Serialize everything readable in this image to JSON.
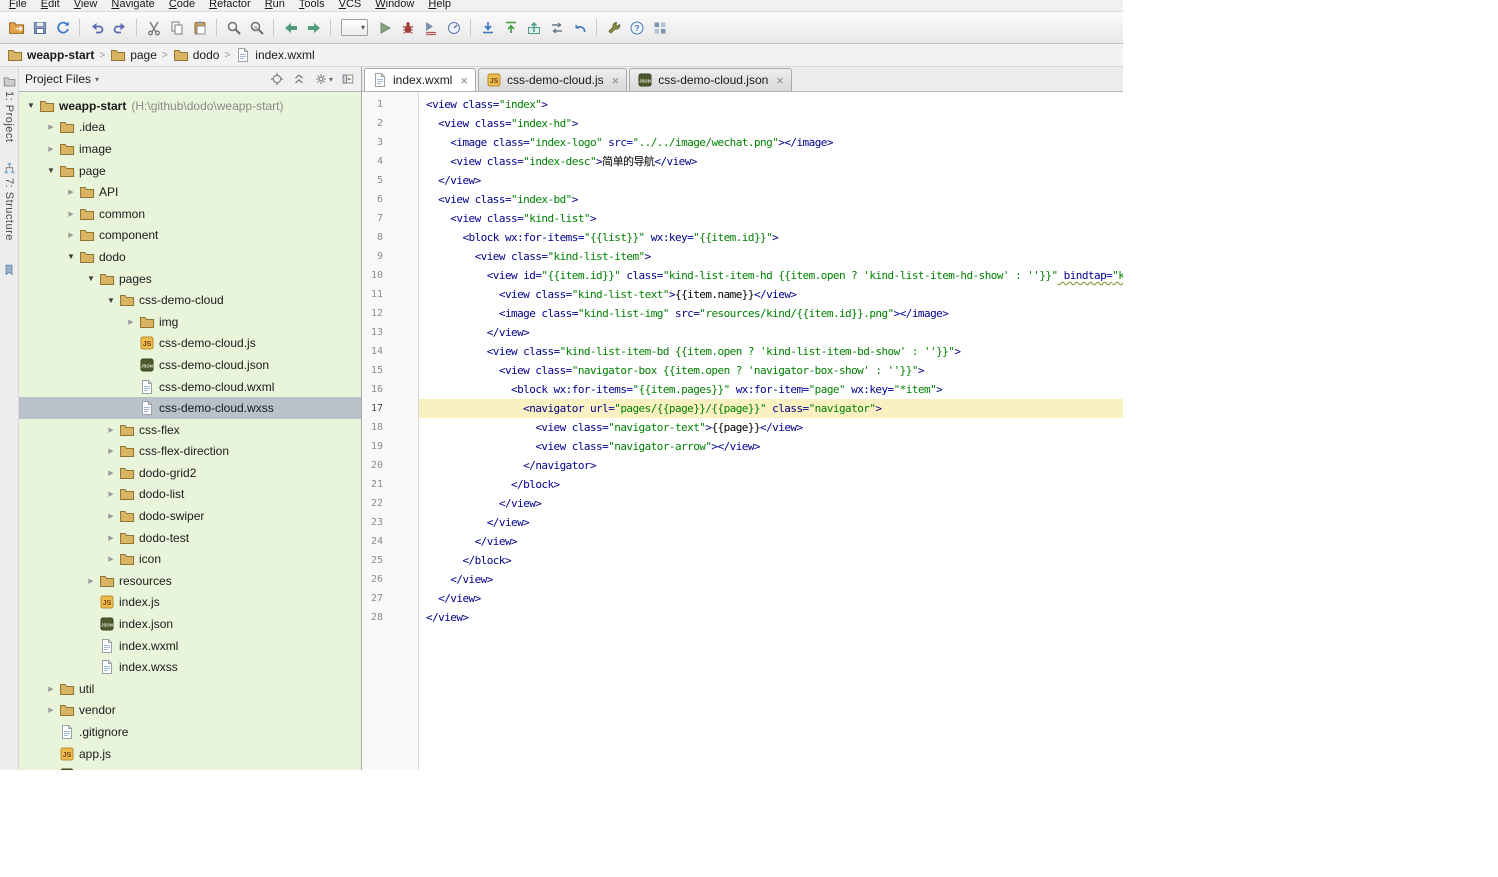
{
  "menu": {
    "items": [
      "File",
      "Edit",
      "View",
      "Navigate",
      "Code",
      "Refactor",
      "Run",
      "Tools",
      "VCS",
      "Window",
      "Help"
    ]
  },
  "toolbar": {
    "items": [
      {
        "icon": "open-icon"
      },
      {
        "icon": "save-icon"
      },
      {
        "icon": "sync-icon"
      },
      {
        "sep": true
      },
      {
        "icon": "undo-icon"
      },
      {
        "icon": "redo-icon"
      },
      {
        "sep": true
      },
      {
        "icon": "cut-icon"
      },
      {
        "icon": "copy-icon"
      },
      {
        "icon": "paste-icon"
      },
      {
        "sep": true
      },
      {
        "icon": "find-icon"
      },
      {
        "icon": "replace-icon"
      },
      {
        "sep": true
      },
      {
        "icon": "back-icon"
      },
      {
        "icon": "forward-icon"
      },
      {
        "sep": true
      },
      {
        "combo": "run-config-selector"
      },
      {
        "icon": "run-icon"
      },
      {
        "icon": "debug-icon"
      },
      {
        "icon": "coverage-icon"
      },
      {
        "icon": "profiler-icon"
      },
      {
        "sep": true
      },
      {
        "icon": "vcs-update-icon"
      },
      {
        "icon": "vcs-commit-icon"
      },
      {
        "icon": "vcs-push-icon"
      },
      {
        "icon": "vcs-compare-icon"
      },
      {
        "icon": "rollback-icon"
      },
      {
        "sep": true
      },
      {
        "icon": "settings-wrench-icon"
      },
      {
        "icon": "help-icon"
      },
      {
        "icon": "project-structure-icon"
      }
    ]
  },
  "breadcrumbs": {
    "separator": ">",
    "items": [
      {
        "label": "weapp-start",
        "icon": "folder",
        "bold": true
      },
      {
        "label": "page",
        "icon": "folder"
      },
      {
        "label": "dodo",
        "icon": "folder"
      },
      {
        "label": "index.wxml",
        "icon": "file"
      }
    ]
  },
  "tool_strip": {
    "buttons": [
      {
        "label": "1: Project",
        "icon": "project-tool-icon"
      },
      {
        "label": "7: Structure",
        "icon": "structure-tool-icon"
      }
    ]
  },
  "project_panel": {
    "header": {
      "label": "Project Files",
      "icons": [
        "locate-icon",
        "collapse-all-icon",
        "gear-icon",
        "hide-panel-icon"
      ]
    },
    "tree": [
      {
        "label": "weapp-start",
        "suffix": " (H:\\github\\dodo\\weapp-start)",
        "depth": 0,
        "icon": "folder",
        "state": "expanded",
        "bold": true
      },
      {
        "label": ".idea",
        "depth": 1,
        "icon": "folder",
        "state": "collapsed"
      },
      {
        "label": "image",
        "depth": 1,
        "icon": "folder",
        "state": "collapsed"
      },
      {
        "label": "page",
        "depth": 1,
        "icon": "folder",
        "state": "expanded"
      },
      {
        "label": "API",
        "depth": 2,
        "icon": "folder",
        "state": "collapsed"
      },
      {
        "label": "common",
        "depth": 2,
        "icon": "folder",
        "state": "collapsed"
      },
      {
        "label": "component",
        "depth": 2,
        "icon": "folder",
        "state": "collapsed"
      },
      {
        "label": "dodo",
        "depth": 2,
        "icon": "folder",
        "state": "expanded"
      },
      {
        "label": "pages",
        "depth": 3,
        "icon": "folder",
        "state": "expanded"
      },
      {
        "label": "css-demo-cloud",
        "depth": 4,
        "icon": "folder",
        "state": "expanded"
      },
      {
        "label": "img",
        "depth": 5,
        "icon": "folder",
        "state": "collapsed"
      },
      {
        "label": "css-demo-cloud.js",
        "depth": 5,
        "icon": "js"
      },
      {
        "label": "css-demo-cloud.json",
        "depth": 5,
        "icon": "json"
      },
      {
        "label": "css-demo-cloud.wxml",
        "depth": 5,
        "icon": "file"
      },
      {
        "label": "css-demo-cloud.wxss",
        "depth": 5,
        "icon": "file",
        "selected": true
      },
      {
        "label": "css-flex",
        "depth": 4,
        "icon": "folder",
        "state": "collapsed"
      },
      {
        "label": "css-flex-direction",
        "depth": 4,
        "icon": "folder",
        "state": "collapsed"
      },
      {
        "label": "dodo-grid2",
        "depth": 4,
        "icon": "folder",
        "state": "collapsed"
      },
      {
        "label": "dodo-list",
        "depth": 4,
        "icon": "folder",
        "state": "collapsed"
      },
      {
        "label": "dodo-swiper",
        "depth": 4,
        "icon": "folder",
        "state": "collapsed"
      },
      {
        "label": "dodo-test",
        "depth": 4,
        "icon": "folder",
        "state": "collapsed"
      },
      {
        "label": "icon",
        "depth": 4,
        "icon": "folder",
        "state": "collapsed"
      },
      {
        "label": "resources",
        "depth": 3,
        "icon": "folder",
        "state": "collapsed"
      },
      {
        "label": "index.js",
        "depth": 3,
        "icon": "js"
      },
      {
        "label": "index.json",
        "depth": 3,
        "icon": "json"
      },
      {
        "label": "index.wxml",
        "depth": 3,
        "icon": "file"
      },
      {
        "label": "index.wxss",
        "depth": 3,
        "icon": "file"
      },
      {
        "label": "util",
        "depth": 1,
        "icon": "folder",
        "state": "collapsed"
      },
      {
        "label": "vendor",
        "depth": 1,
        "icon": "folder",
        "state": "collapsed"
      },
      {
        "label": ".gitignore",
        "depth": 1,
        "icon": "file"
      },
      {
        "label": "app.js",
        "depth": 1,
        "icon": "js"
      },
      {
        "label": "app.json",
        "depth": 1,
        "icon": "json"
      },
      {
        "label": "",
        "depth": 1,
        "icon": "file",
        "partial": true
      }
    ]
  },
  "editor": {
    "tabs": [
      {
        "label": "index.wxml",
        "icon": "file",
        "active": true
      },
      {
        "label": "css-demo-cloud.js",
        "icon": "js"
      },
      {
        "label": "css-demo-cloud.json",
        "icon": "json"
      }
    ],
    "current_line": 17,
    "lines": [
      {
        "no": 1,
        "code": "<view class=\"index\">"
      },
      {
        "no": 2,
        "code": "  <view class=\"index-hd\">"
      },
      {
        "no": 3,
        "code": "    <image class=\"index-logo\" src=\"../../image/wechat.png\"></image>"
      },
      {
        "no": 4,
        "code": "    <view class=\"index-desc\">简单的导航</view>"
      },
      {
        "no": 5,
        "code": "  </view>"
      },
      {
        "no": 6,
        "code": "  <view class=\"index-bd\">"
      },
      {
        "no": 7,
        "code": "    <view class=\"kind-list\">"
      },
      {
        "no": 8,
        "code": "      <block wx:for-items=\"{{list}}\" wx:key=\"{{item.id}}\">"
      },
      {
        "no": 9,
        "code": "        <view class=\"kind-list-item\">"
      },
      {
        "no": 10,
        "warning": true,
        "code": "          <view id=\"{{item.id}}\" class=\"kind-list-item-hd {{item.open ? 'kind-list-item-hd-show' : ''}}\" bindtap=\"ki"
      },
      {
        "no": 11,
        "code": "            <view class=\"kind-list-text\">{{item.name}}</view>"
      },
      {
        "no": 12,
        "code": "            <image class=\"kind-list-img\" src=\"resources/kind/{{item.id}}.png\"></image>"
      },
      {
        "no": 13,
        "code": "          </view>"
      },
      {
        "no": 14,
        "code": "          <view class=\"kind-list-item-bd {{item.open ? 'kind-list-item-bd-show' : ''}}\">"
      },
      {
        "no": 15,
        "code": "            <view class=\"navigator-box {{item.open ? 'navigator-box-show' : ''}}\">"
      },
      {
        "no": 16,
        "code": "              <block wx:for-items=\"{{item.pages}}\" wx:for-item=\"page\" wx:key=\"*item\">"
      },
      {
        "no": 17,
        "code": "                <navigator url=\"pages/{{page}}/{{page}}\" class=\"navigator\">"
      },
      {
        "no": 18,
        "code": "                  <view class=\"navigator-text\">{{page}}</view>"
      },
      {
        "no": 19,
        "code": "                  <view class=\"navigator-arrow\"></view>"
      },
      {
        "no": 20,
        "code": "                </navigator>"
      },
      {
        "no": 21,
        "code": "              </block>"
      },
      {
        "no": 22,
        "code": "            </view>"
      },
      {
        "no": 23,
        "code": "          </view>"
      },
      {
        "no": 24,
        "code": "        </view>"
      },
      {
        "no": 25,
        "code": "      </block>"
      },
      {
        "no": 26,
        "code": "    </view>"
      },
      {
        "no": 27,
        "code": "  </view>"
      },
      {
        "no": 28,
        "code": "</view>"
      }
    ]
  },
  "colors": {
    "tree_background": "#e9f5da",
    "tree_selection": "#b9c2ca",
    "current_line_highlight": "#faf1c2",
    "tag_color": "#00008b",
    "string_color": "#008000"
  }
}
